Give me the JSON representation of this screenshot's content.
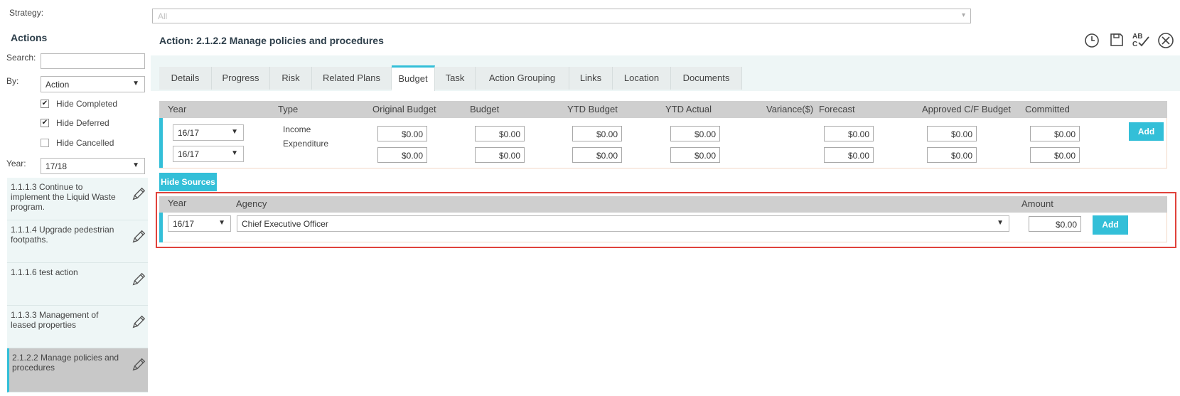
{
  "strategy": {
    "label": "Strategy:",
    "value": "All"
  },
  "sidebar": {
    "title": "Actions",
    "search_label": "Search:",
    "search_value": "",
    "by_label": "By:",
    "by_value": "Action",
    "hide_completed": "Hide Completed",
    "hide_deferred": "Hide Deferred",
    "hide_cancelled": "Hide Cancelled",
    "year_label": "Year:",
    "year_value": "17/18",
    "items": [
      {
        "label": "1.1.1.3 Continue to implement the Liquid Waste program."
      },
      {
        "label": "1.1.1.4 Upgrade pedestrian footpaths."
      },
      {
        "label": "1.1.1.6 test action"
      },
      {
        "label": "1.1.3.3 Management of leased properties"
      },
      {
        "label": "2.1.2.2 Manage policies and procedures"
      }
    ]
  },
  "main": {
    "title": "Action: 2.1.2.2 Manage policies and procedures",
    "tabs": [
      "Details",
      "Progress",
      "Risk",
      "Related Plans",
      "Budget",
      "Task",
      "Action Grouping",
      "Links",
      "Location",
      "Documents"
    ],
    "budget": {
      "headers": {
        "year": "Year",
        "type": "Type",
        "original": "Original Budget",
        "budget": "Budget",
        "ytd_budget": "YTD Budget",
        "ytd_actual": "YTD Actual",
        "variance": "Variance($)",
        "forecast": "Forecast",
        "approved": "Approved C/F Budget",
        "committed": "Committed"
      },
      "rows": [
        {
          "year": "16/17",
          "type": "Income",
          "original": "$0.00",
          "budget": "$0.00",
          "ytd_budget": "$0.00",
          "ytd_actual": "$0.00",
          "forecast": "$0.00",
          "approved": "$0.00",
          "committed": "$0.00"
        },
        {
          "year": "16/17",
          "type": "Expenditure",
          "original": "$0.00",
          "budget": "$0.00",
          "ytd_budget": "$0.00",
          "ytd_actual": "$0.00",
          "forecast": "$0.00",
          "approved": "$0.00",
          "committed": "$0.00"
        }
      ],
      "add_label": "Add"
    },
    "hide_sources_label": "Hide Sources",
    "sources": {
      "headers": {
        "year": "Year",
        "agency": "Agency",
        "amount": "Amount"
      },
      "row": {
        "year": "16/17",
        "agency": "Chief Executive Officer",
        "amount": "$0.00"
      },
      "add_label": "Add"
    },
    "toolbar_icons": [
      "history-icon",
      "save-icon",
      "spellcheck-icon",
      "close-icon"
    ],
    "highlight_color": "#e0423b",
    "accent_color": "#33bfd8"
  }
}
